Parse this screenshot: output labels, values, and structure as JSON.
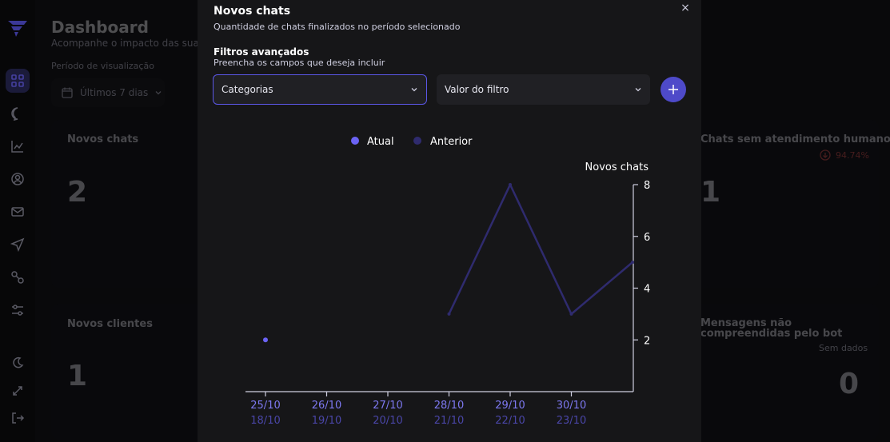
{
  "dashboard": {
    "title": "Dashboard",
    "subtitle": "Acompanhe o impacto das suas",
    "period_label": "Período de visualização",
    "period_value": "Últimos 7 dias",
    "cards": [
      {
        "title": "Novos chats",
        "value": "2"
      },
      {
        "title": "Chats sem atendimento humano",
        "value": "1",
        "badge": "94.74%"
      },
      {
        "title": "Novos clientes",
        "value": "1"
      },
      {
        "title": "Mensagens não compreendidas pelo bot",
        "value": "0",
        "note": "Sem dados"
      }
    ]
  },
  "sidebar": {
    "items": [
      "logo-icon",
      "dashboard-icon",
      "chat-icon",
      "chart-icon",
      "user-icon",
      "mail-icon",
      "send-icon",
      "integration-icon",
      "settings-icon",
      "moon-icon",
      "expand-icon",
      "logout-icon"
    ]
  },
  "modal": {
    "title": "Novos chats",
    "subtitle": "Quantidade de chats finalizados no período selecionado",
    "close_label": "×",
    "filters_title": "Filtros avançados",
    "filters_subtitle": "Preencha os campos que deseja incluir",
    "category_select": "Categorias",
    "filter_value_select": "Valor do filtro",
    "add_label": "+"
  },
  "colors": {
    "accent": "#5b57e8",
    "current_series": "#6b63f5",
    "previous_series": "#2f2b6e",
    "negative": "#e05252"
  },
  "chart_data": {
    "type": "line",
    "ylabel": "Novos chats",
    "ylim": [
      0,
      8
    ],
    "y_ticks": [
      2,
      4,
      6,
      8
    ],
    "categories_current": [
      "25/10",
      "26/10",
      "27/10",
      "28/10",
      "29/10",
      "30/10"
    ],
    "categories_previous": [
      "18/10",
      "19/10",
      "20/10",
      "21/10",
      "22/10",
      "23/10"
    ],
    "series": [
      {
        "name": "Atual",
        "values": [
          2,
          null,
          null,
          null,
          null,
          null,
          null
        ]
      },
      {
        "name": "Anterior",
        "values": [
          null,
          null,
          null,
          3,
          8,
          3,
          5
        ]
      }
    ],
    "legend": "top-center"
  }
}
